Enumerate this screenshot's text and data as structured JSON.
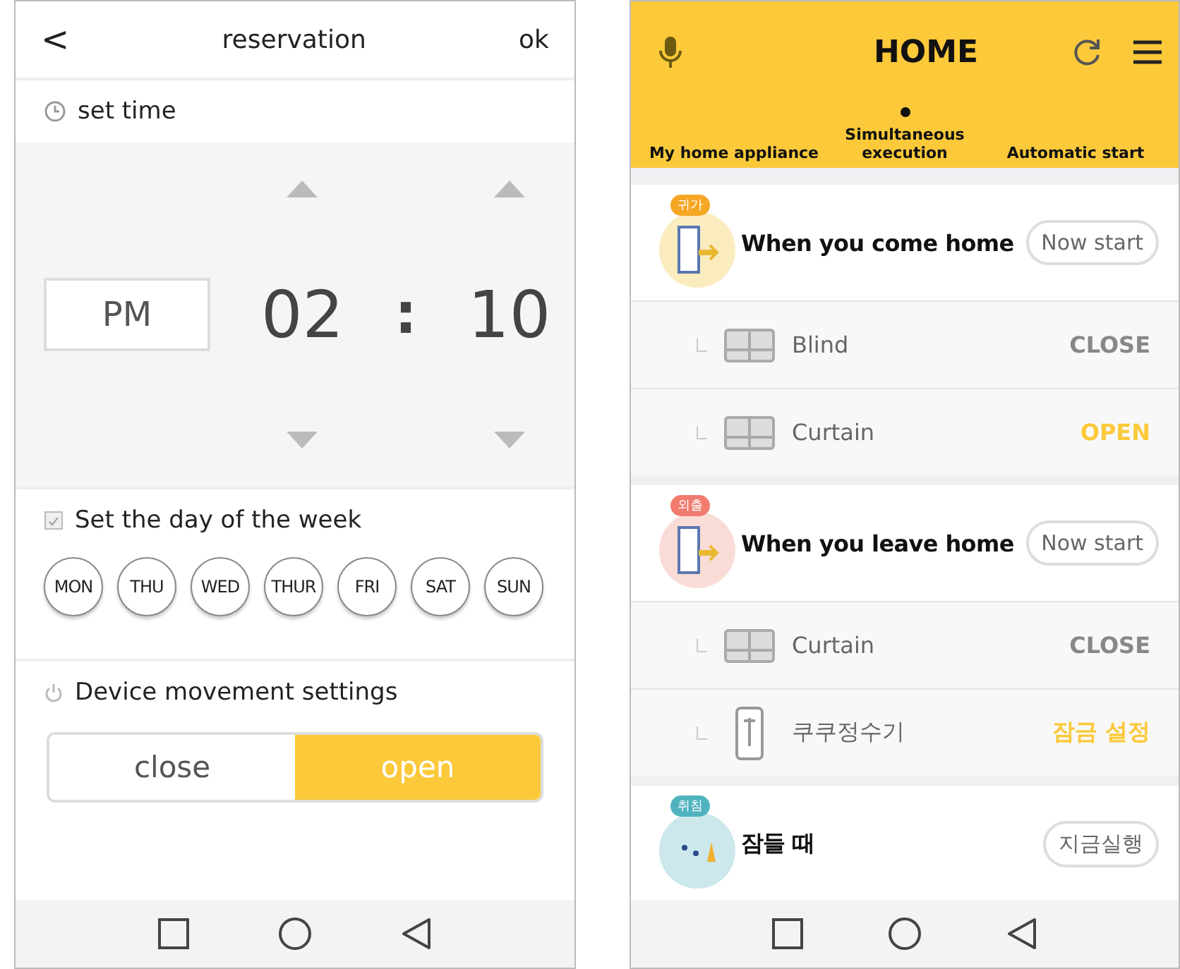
{
  "reservation": {
    "back": "<",
    "title": "reservation",
    "ok": "ok",
    "time_section": {
      "label": "set time"
    },
    "time": {
      "meridiem": "PM",
      "hour": "02",
      "separator": ":",
      "minute": "10"
    },
    "days_section": {
      "label": "Set the day of the week"
    },
    "days": [
      {
        "label": "MON",
        "selected": false
      },
      {
        "label": "THU",
        "selected": false
      },
      {
        "label": "WED",
        "selected": false
      },
      {
        "label": "THUR",
        "selected": false
      },
      {
        "label": "FRI",
        "selected": false
      },
      {
        "label": "SAT",
        "selected": false
      },
      {
        "label": "SUN",
        "selected": false
      }
    ],
    "movement_section": {
      "label": "Device movement settings"
    },
    "movement": [
      {
        "label": "close",
        "selected": false
      },
      {
        "label": "open",
        "selected": true
      }
    ]
  },
  "home": {
    "title": "HOME",
    "tabs": [
      {
        "label": "My home appliance",
        "selected": false
      },
      {
        "label": "Simultaneous execution",
        "selected": true
      },
      {
        "label": "Automatic start",
        "selected": false
      }
    ],
    "groups": [
      {
        "badge": "귀가",
        "color": "#f5a623",
        "kind": "come",
        "title": "When you come home",
        "button": "Now start",
        "items": [
          {
            "kind": "curtain",
            "name": "Blind",
            "status": "CLOSE",
            "active": false
          },
          {
            "kind": "curtain",
            "name": "Curtain",
            "status": "OPEN",
            "active": true
          }
        ]
      },
      {
        "badge": "외출",
        "color": "#f07b6e",
        "kind": "leave",
        "title": "When you leave home",
        "button": "Now start",
        "items": [
          {
            "kind": "curtain",
            "name": "Curtain",
            "status": "CLOSE",
            "active": false
          },
          {
            "kind": "purifier",
            "name": "쿠쿠정수기",
            "status": "잠금 설정",
            "active": true
          }
        ]
      },
      {
        "badge": "취침",
        "color": "#4fb3bf",
        "kind": "sleep",
        "title": "잠들 때",
        "button": "지금실행"
      }
    ]
  }
}
